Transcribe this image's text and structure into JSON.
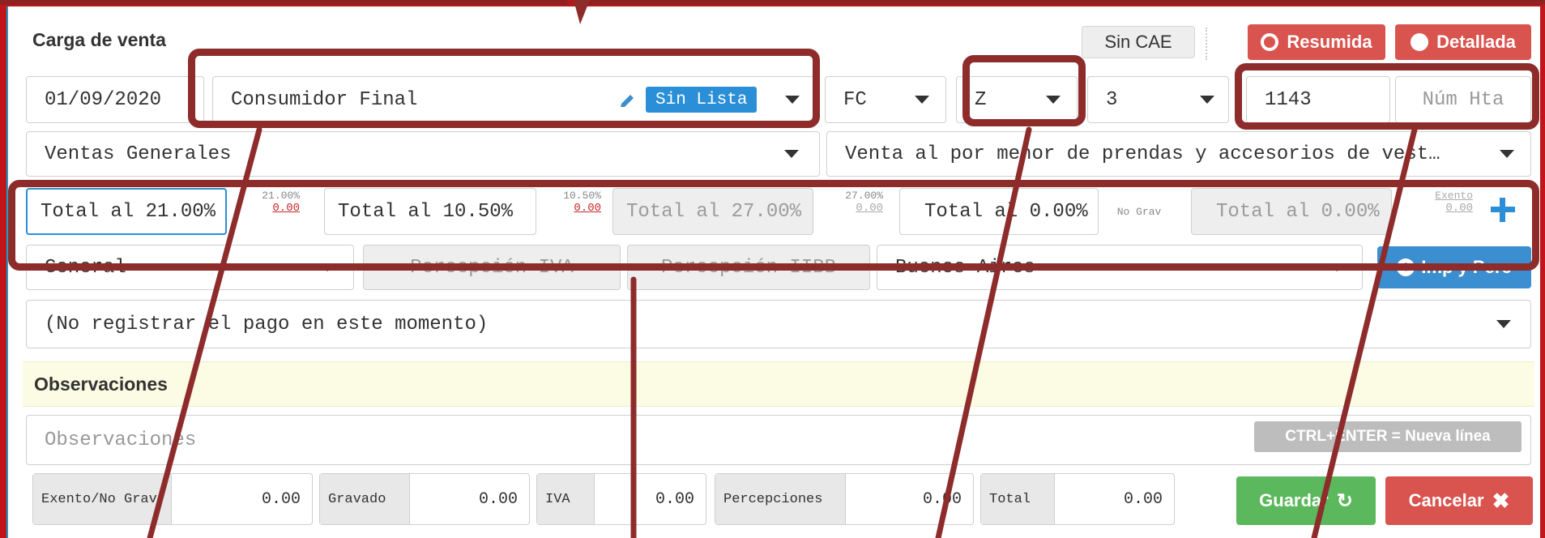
{
  "title": "Carga de venta",
  "cae_status": "Sin CAE",
  "view_toggle": {
    "summary": "Resumida",
    "detailed": "Detallada"
  },
  "invoice": {
    "date": "01/09/2020",
    "customer": "Consumidor Final",
    "price_list_badge": "Sin Lista",
    "voucher_type": "FC",
    "letter": "Z",
    "point_of_sale": "3",
    "number_from": "1143",
    "number_to_placeholder": "Núm Hta"
  },
  "category": "Ventas Generales",
  "activity": "Venta al por menor de prendas y accesorios de vest…",
  "tax_totals": [
    {
      "label": "Total al 21.00%",
      "rate": "21.00%",
      "amount": "0.00"
    },
    {
      "label": "Total al 10.50%",
      "rate": "10.50%",
      "amount": "0.00"
    },
    {
      "label": "Total al 27.00%",
      "rate": "27.00%",
      "amount": "0.00"
    },
    {
      "label": "Total al 0.00%",
      "rate": "No Grav",
      "amount": ""
    },
    {
      "label": "Total al 0.00%",
      "rate": "Exento",
      "amount": "0.00"
    }
  ],
  "perceptions": {
    "type": "General",
    "iva_placeholder": "Percepción IVA",
    "iibb_placeholder": "Percepción IIBB",
    "province": "Buenos Aires",
    "imp_button": "Imp y Perc"
  },
  "payment": "(No registrar el pago en este momento)",
  "observations": {
    "heading": "Observaciones",
    "placeholder": "Observaciones",
    "hint": "CTRL+ENTER = Nueva línea"
  },
  "summary": [
    {
      "label": "Exento/No Grav",
      "value": "0.00"
    },
    {
      "label": "Gravado",
      "value": "0.00"
    },
    {
      "label": "IVA",
      "value": "0.00"
    },
    {
      "label": "Percepciones",
      "value": "0.00"
    },
    {
      "label": "Total",
      "value": "0.00"
    }
  ],
  "actions": {
    "save": "Guardar",
    "cancel": "Cancelar"
  },
  "colors": {
    "accent_red": "#d9534f",
    "accent_green": "#5cb85c",
    "accent_blue": "#3b8ed0",
    "highlight": "#8e2c2c"
  }
}
